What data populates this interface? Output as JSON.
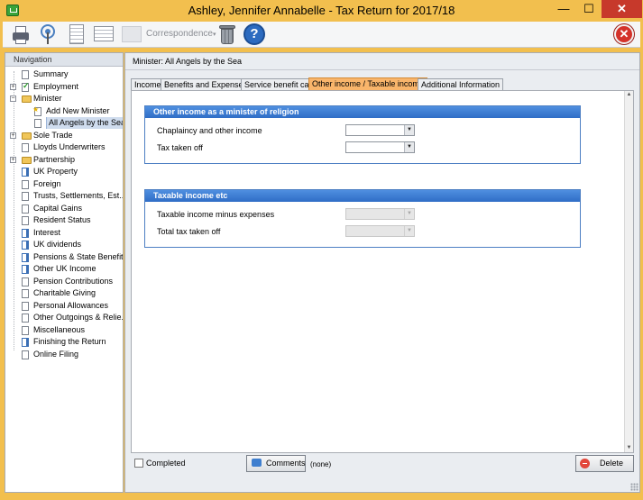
{
  "window": {
    "title": "Ashley, Jennifer Annabelle - Tax Return for 2017/18",
    "minimize_glyph": "—",
    "maximize_glyph": "☐",
    "close_glyph": "✕"
  },
  "toolbar": {
    "correspondence_label": "Correspondence",
    "correspondence_arrow": "▾",
    "help_glyph": "?",
    "close_glyph": "✕"
  },
  "navigation": {
    "header": "Navigation",
    "items": [
      {
        "label": "Summary",
        "icon": "page-icon"
      },
      {
        "label": "Employment",
        "icon": "check-icon",
        "expander": "+"
      },
      {
        "label": "Minister",
        "icon": "folder-open-icon",
        "expander": "−"
      },
      {
        "label": "Add New Minister",
        "icon": "new-item-icon"
      },
      {
        "label": "All Angels by the Sea",
        "icon": "page-icon",
        "selected": true
      },
      {
        "label": "Sole Trade",
        "icon": "folder-icon",
        "expander": "+"
      },
      {
        "label": "Lloyds Underwriters",
        "icon": "page-icon"
      },
      {
        "label": "Partnership",
        "icon": "folder-icon",
        "expander": "+"
      },
      {
        "label": "UK Property",
        "icon": "blue-page-icon"
      },
      {
        "label": "Foreign",
        "icon": "page-icon"
      },
      {
        "label": "Trusts, Settlements, Est...",
        "icon": "page-icon"
      },
      {
        "label": "Capital Gains",
        "icon": "page-icon"
      },
      {
        "label": "Resident Status",
        "icon": "page-icon"
      },
      {
        "label": "Interest",
        "icon": "blue-page-icon"
      },
      {
        "label": "UK dividends",
        "icon": "blue-page-icon"
      },
      {
        "label": "Pensions & State Benefits",
        "icon": "blue-page-icon"
      },
      {
        "label": "Other UK Income",
        "icon": "blue-page-icon"
      },
      {
        "label": "Pension Contributions",
        "icon": "page-icon"
      },
      {
        "label": "Charitable Giving",
        "icon": "page-icon"
      },
      {
        "label": "Personal Allowances",
        "icon": "page-icon"
      },
      {
        "label": "Other Outgoings & Relie...",
        "icon": "page-icon"
      },
      {
        "label": "Miscellaneous",
        "icon": "page-icon"
      },
      {
        "label": "Finishing the Return",
        "icon": "blue-page-icon"
      },
      {
        "label": "Online Filing",
        "icon": "page-icon"
      }
    ]
  },
  "main": {
    "header": "Minister: All Angels by the Sea",
    "tabs": [
      {
        "label": "Income"
      },
      {
        "label": "Benefits and Expenses"
      },
      {
        "label": "Service benefit cap"
      },
      {
        "label": "Other income / Taxable income",
        "active": true
      },
      {
        "label": "Additional Information"
      }
    ],
    "groups": {
      "other_income": {
        "title": "Other income as a minister of religion",
        "fields": [
          {
            "label": "Chaplaincy and other income",
            "value": ""
          },
          {
            "label": "Tax taken off",
            "value": ""
          }
        ]
      },
      "taxable_income": {
        "title": "Taxable income etc",
        "fields": [
          {
            "label": "Taxable income minus expenses",
            "value": ""
          },
          {
            "label": "Total tax taken off",
            "value": ""
          }
        ]
      }
    },
    "combo_arrow": "▼",
    "scroll_up": "▲",
    "scroll_down": "▼"
  },
  "footer": {
    "completed_label": "Completed",
    "comments_label": "Comments",
    "comments_status": "(none)",
    "delete_label": "Delete"
  }
}
